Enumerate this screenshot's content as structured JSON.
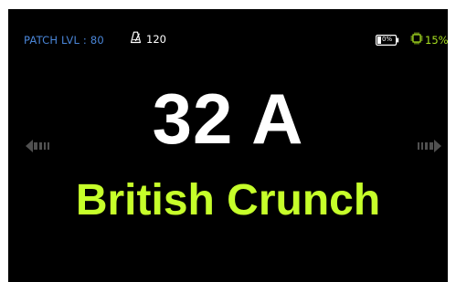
{
  "status": {
    "patch_level": "PATCH LVL : 80",
    "tempo": "120",
    "battery_level": "0%",
    "cpu_load": "15%"
  },
  "patch": {
    "number": "32 A",
    "name": "British Crunch"
  },
  "icons": {
    "tempo": "metronome-icon",
    "battery": "battery-icon",
    "cpu": "cpu-chip-icon",
    "prev": "arrow-left-icon",
    "next": "arrow-right-icon"
  },
  "colors": {
    "background": "#000000",
    "patch_level_text": "#4a86d8",
    "patch_name_text": "#c6ff2a",
    "cpu_text": "#a8e020",
    "nav_arrows": "#505050"
  }
}
